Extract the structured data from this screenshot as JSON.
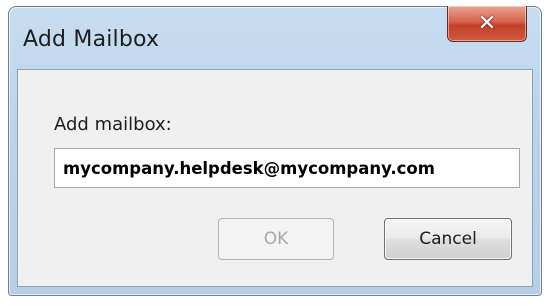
{
  "window": {
    "title": "Add Mailbox",
    "close_icon": "close-icon"
  },
  "form": {
    "label": "Add mailbox:",
    "mailbox_value": "mycompany.helpdesk@mycompany.com"
  },
  "buttons": {
    "ok_label": "OK",
    "ok_enabled": false,
    "cancel_label": "Cancel"
  },
  "colors": {
    "frame": "#bcd3ea",
    "close_button": "#c2402a",
    "client_bg": "#f0f0f0"
  }
}
